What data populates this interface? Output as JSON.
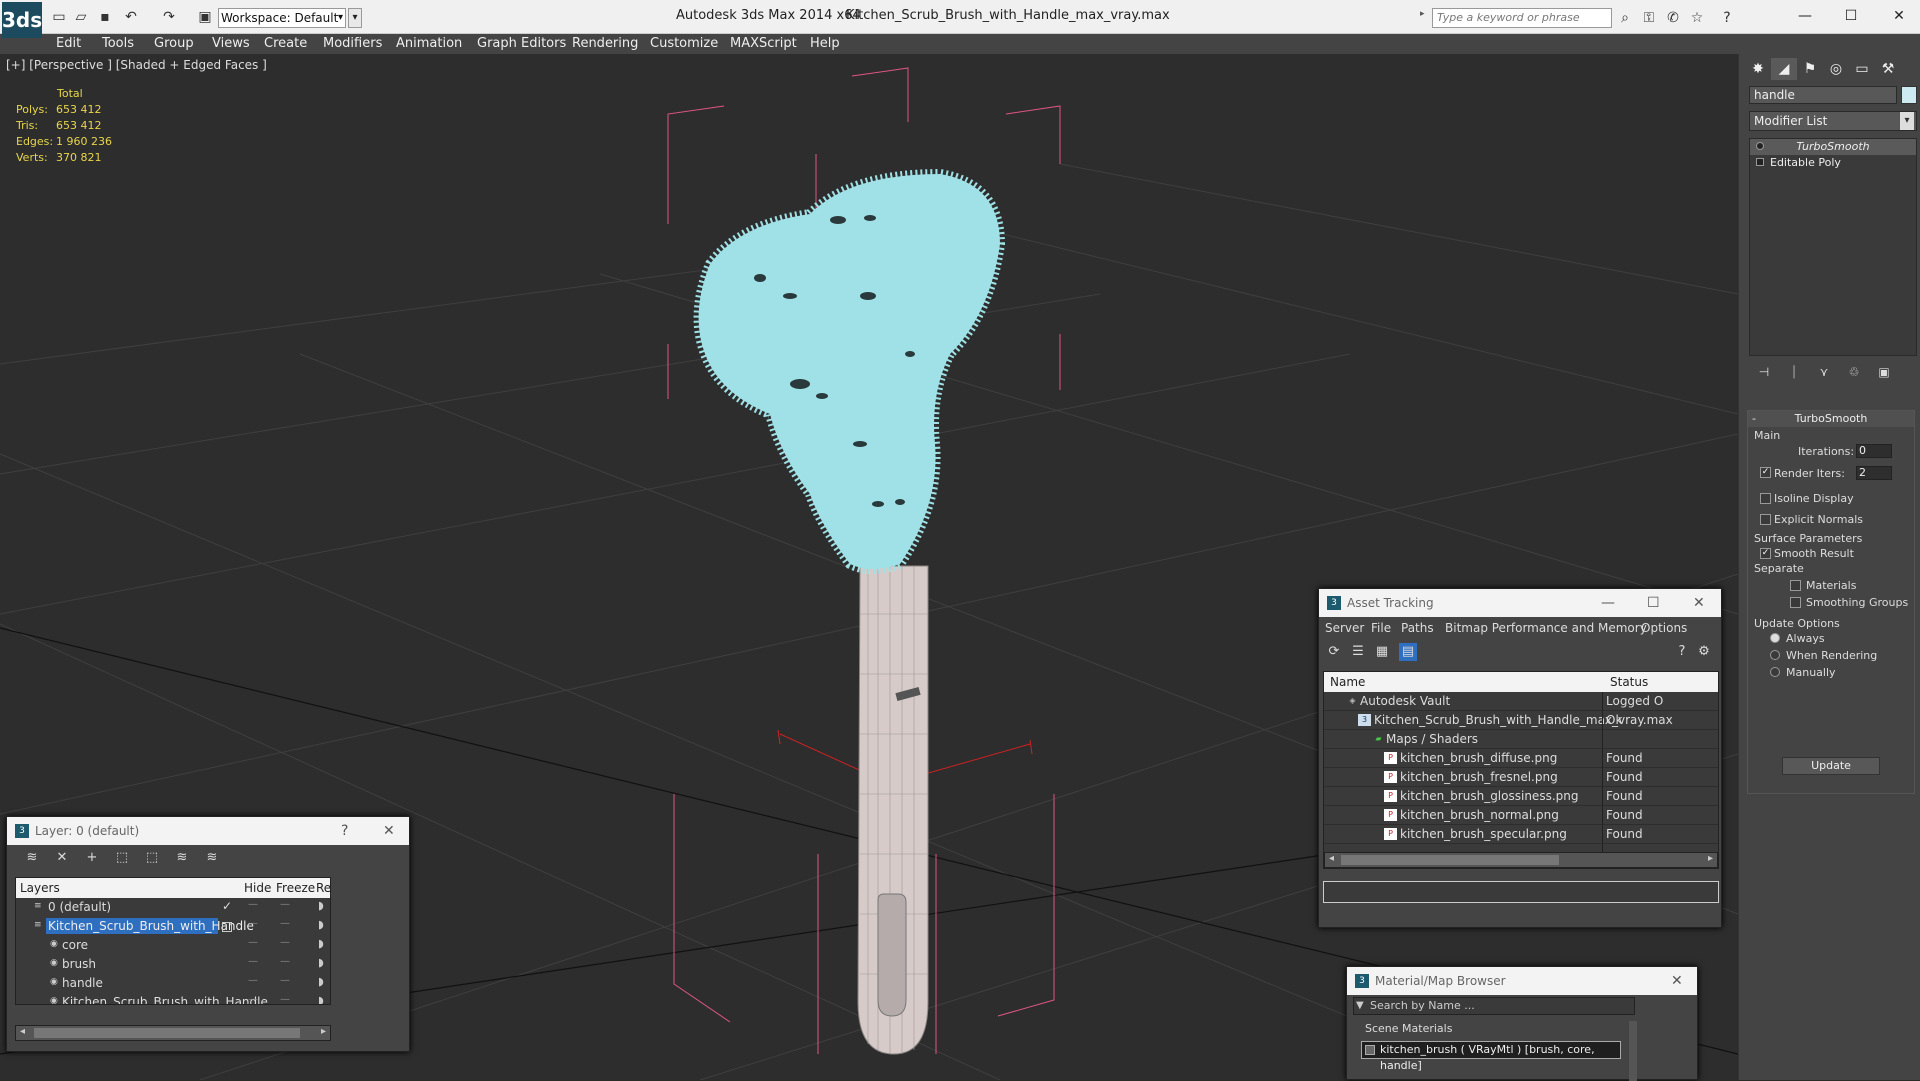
{
  "titlebar": {
    "app_logo": "3ds",
    "workspace": "Workspace: Default",
    "app_title": "Autodesk 3ds Max  2014 x64",
    "file_title": "Kitchen_Scrub_Brush_with_Handle_max_vray.max",
    "search_placeholder": "Type a keyword or phrase"
  },
  "menu": [
    "Edit",
    "Tools",
    "Group",
    "Views",
    "Create",
    "Modifiers",
    "Animation",
    "Graph Editors",
    "Rendering",
    "Customize",
    "MAXScript",
    "Help"
  ],
  "viewport": {
    "label": "[+] [Perspective ] [Shaded + Edged Faces ]",
    "stats": {
      "header": "Total",
      "rows": [
        {
          "k": "Polys:",
          "v": "653 412"
        },
        {
          "k": "Tris:",
          "v": "653 412"
        },
        {
          "k": "Edges:",
          "v": "1 960 236"
        },
        {
          "k": "Verts:",
          "v": "370 821"
        }
      ]
    }
  },
  "command_panel": {
    "object_name": "handle",
    "modifier_list": "Modifier List",
    "stack": [
      "TurboSmooth",
      "Editable Poly"
    ],
    "turbosmooth": {
      "title": "TurboSmooth",
      "main": "Main",
      "iterations_label": "Iterations:",
      "iterations": "0",
      "render_iters_label": "Render Iters:",
      "render_iters": "2",
      "isoline": "Isoline Display",
      "explicit_normals": "Explicit Normals",
      "surface_params": "Surface Parameters",
      "smooth_result": "Smooth Result",
      "separate": "Separate",
      "materials": "Materials",
      "smoothing_groups": "Smoothing Groups",
      "update_options": "Update Options",
      "always": "Always",
      "when_rendering": "When Rendering",
      "manually": "Manually",
      "update_btn": "Update"
    }
  },
  "asset_tracking": {
    "title": "Asset Tracking",
    "menu": [
      "Server",
      "File",
      "Paths",
      "Bitmap Performance and Memory",
      "Options"
    ],
    "col_name": "Name",
    "col_status": "Status",
    "rows": [
      {
        "name": "Autodesk Vault",
        "status": "Logged O",
        "indent": 0,
        "icon": "vault"
      },
      {
        "name": "Kitchen_Scrub_Brush_with_Handle_max_vray.max",
        "status": "Ok",
        "indent": 1,
        "icon": "max"
      },
      {
        "name": "Maps / Shaders",
        "status": "",
        "indent": 2,
        "icon": "folder"
      },
      {
        "name": "kitchen_brush_diffuse.png",
        "status": "Found",
        "indent": 3,
        "icon": "png"
      },
      {
        "name": "kitchen_brush_fresnel.png",
        "status": "Found",
        "indent": 3,
        "icon": "png"
      },
      {
        "name": "kitchen_brush_glossiness.png",
        "status": "Found",
        "indent": 3,
        "icon": "png"
      },
      {
        "name": "kitchen_brush_normal.png",
        "status": "Found",
        "indent": 3,
        "icon": "png"
      },
      {
        "name": "kitchen_brush_specular.png",
        "status": "Found",
        "indent": 3,
        "icon": "png"
      }
    ]
  },
  "layer_manager": {
    "title": "Layer: 0 (default)",
    "help": "?",
    "cols": [
      "Layers",
      "Hide",
      "Freeze",
      "Rend"
    ],
    "rows": [
      {
        "name": "0 (default)",
        "indent": 1,
        "sel": false
      },
      {
        "name": "Kitchen_Scrub_Brush_with_Handle",
        "indent": 1,
        "sel": true
      },
      {
        "name": "core",
        "indent": 2,
        "sel": false
      },
      {
        "name": "brush",
        "indent": 2,
        "sel": false
      },
      {
        "name": "handle",
        "indent": 2,
        "sel": false
      },
      {
        "name": "Kitchen_Scrub_Brush_with_Handle",
        "indent": 2,
        "sel": false
      }
    ]
  },
  "material_browser": {
    "title": "Material/Map Browser",
    "search": "Search by Name ...",
    "section": "Scene Materials",
    "item": "kitchen_brush  ( VRayMtl ) [brush, core, handle]"
  }
}
